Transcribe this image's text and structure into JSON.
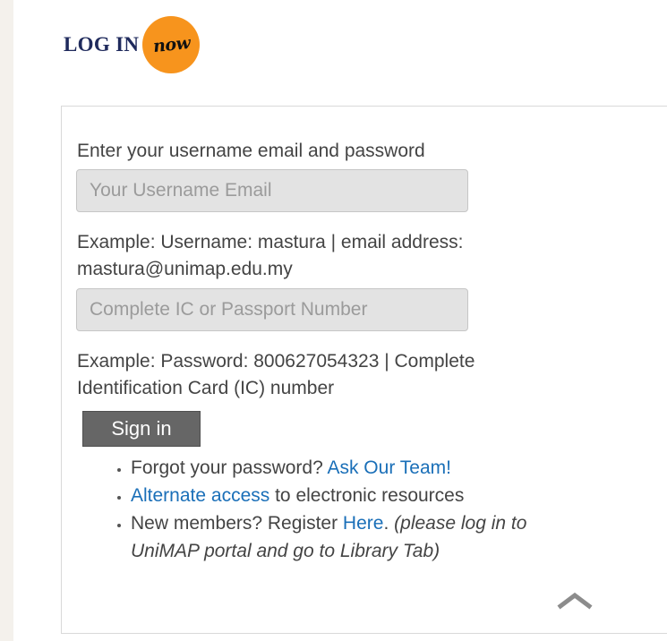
{
  "logo": {
    "text": "LOG IN",
    "badge": "now",
    "badge_color": "#f7941d",
    "text_color": "#1f2a5c"
  },
  "form": {
    "prompt": "Enter your username email and password",
    "username": {
      "value": "",
      "placeholder": "Your Username Email"
    },
    "username_hint_1": "Example: Username: mastura | email address:",
    "username_hint_2": "mastura@unimap.edu.my",
    "password": {
      "value": "",
      "placeholder": "Complete IC or Passport Number"
    },
    "password_hint_1": "Example: Password: 800627054323 | Complete",
    "password_hint_2": "Identification Card (IC) number",
    "signin_label": "Sign in"
  },
  "links": {
    "forgot_text": "Forgot your password?",
    "forgot_link": "Ask Our Team!",
    "alternate_link": "Alternate access",
    "alternate_text": "to electronic resources",
    "register_text": "New members? Register",
    "register_link": "Here",
    "register_period": ".",
    "register_note_1": "(please log in to",
    "register_note_2": "UniMAP portal and go to Library Tab)"
  },
  "icons": {
    "collapse": "chevron-up-icon"
  },
  "colors": {
    "link": "#1a6fb8",
    "button": "#666666"
  }
}
